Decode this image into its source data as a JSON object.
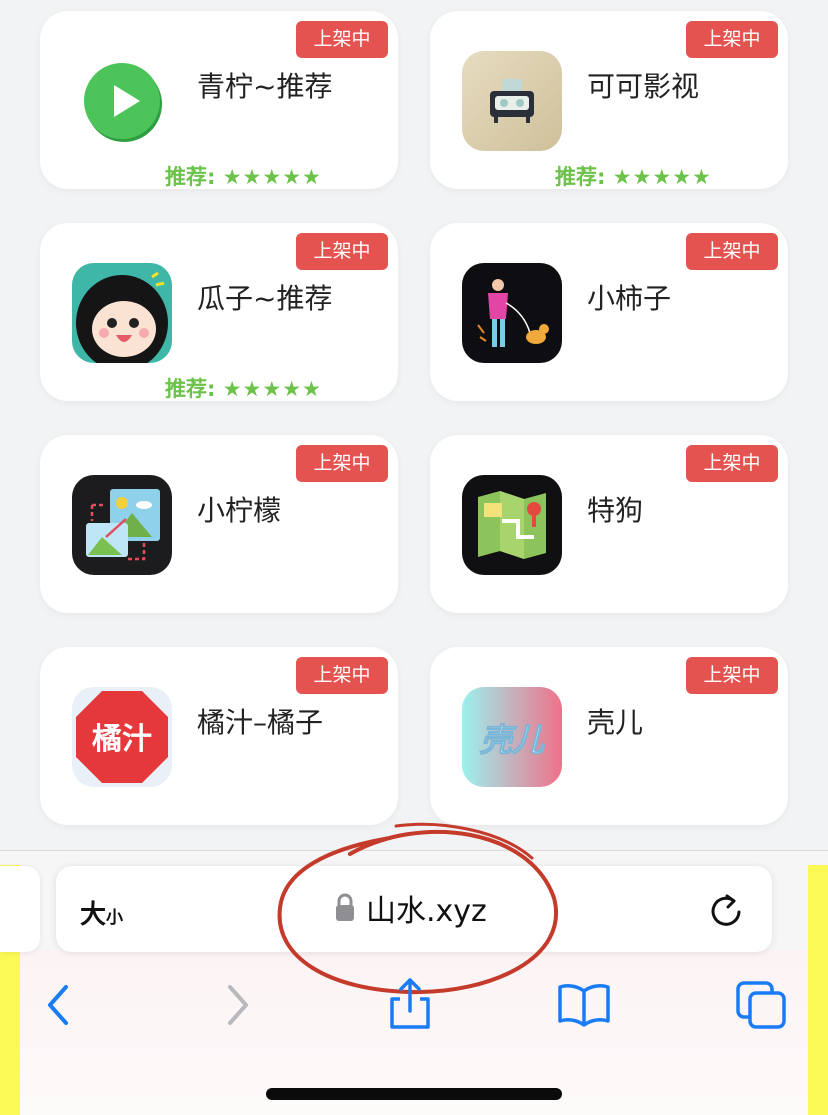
{
  "apps": [
    {
      "name": "青柠~推荐",
      "status": "上架中",
      "icon": "green-play-icon",
      "recommend_label": "推荐:",
      "recommend_stars": "★★★★★"
    },
    {
      "name": "可可影视",
      "status": "上架中",
      "icon": "tv-set-icon",
      "recommend_label": "推荐:",
      "recommend_stars": "★★★★★"
    },
    {
      "name": "瓜子~推荐",
      "status": "上架中",
      "icon": "cartoon-girl-icon",
      "recommend_label": "推荐:",
      "recommend_stars": "★★★★★"
    },
    {
      "name": "小柿子",
      "status": "上架中",
      "icon": "woman-with-dog-icon"
    },
    {
      "name": "小柠檬",
      "status": "上架中",
      "icon": "photo-frames-icon"
    },
    {
      "name": "特狗",
      "status": "上架中",
      "icon": "map-icon"
    },
    {
      "name": "橘汁–橘子",
      "status": "上架中",
      "icon": "red-octagon-icon",
      "icon_text": "橘汁"
    },
    {
      "name": "壳儿",
      "status": "上架中",
      "icon": "gradient-logo-icon",
      "icon_text": "壳儿"
    }
  ],
  "browser": {
    "text_size_label": "大",
    "text_size_small": "小",
    "url": "山水.xyz",
    "lock_icon": "lock-icon",
    "reload_icon": "reload-icon",
    "toolbar": [
      "back-icon",
      "forward-icon",
      "share-icon",
      "bookmarks-icon",
      "tabs-icon"
    ]
  },
  "colors": {
    "badge": "#e55350",
    "recommend": "#6cc24a",
    "accent": "#1a7cf5",
    "annotation": "#c43a2b",
    "side_bars": "#fbfa55"
  }
}
